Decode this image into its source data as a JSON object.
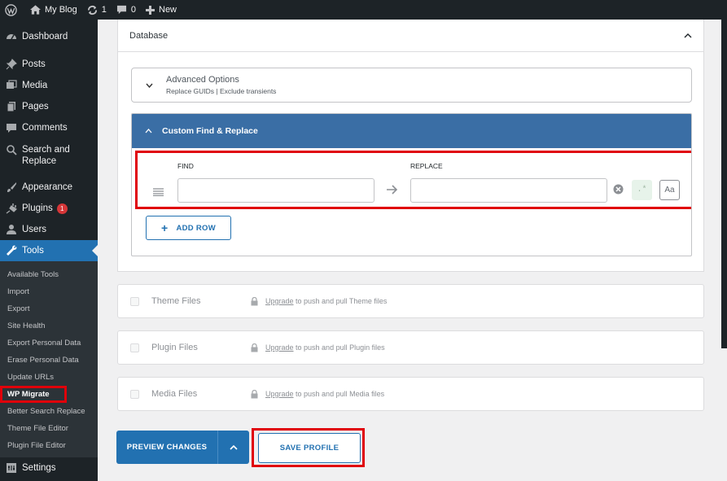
{
  "adminbar": {
    "site_name": "My Blog",
    "updates_count": "1",
    "comments_count": "0",
    "new_label": "New"
  },
  "sidebar": {
    "items": [
      {
        "label": "Dashboard",
        "icon": "dashboard-icon"
      },
      {
        "label": "Posts",
        "icon": "pin-icon"
      },
      {
        "label": "Media",
        "icon": "media-icon"
      },
      {
        "label": "Pages",
        "icon": "pages-icon"
      },
      {
        "label": "Comments",
        "icon": "comment-icon"
      },
      {
        "label": "Search and Replace",
        "icon": "search-icon"
      },
      {
        "label": "Appearance",
        "icon": "brush-icon"
      },
      {
        "label": "Plugins",
        "icon": "plugin-icon",
        "badge": "1"
      },
      {
        "label": "Users",
        "icon": "user-icon"
      },
      {
        "label": "Tools",
        "icon": "wrench-icon"
      },
      {
        "label": "Settings",
        "icon": "settings-icon"
      }
    ],
    "tools_submenu": [
      "Available Tools",
      "Import",
      "Export",
      "Site Health",
      "Export Personal Data",
      "Erase Personal Data",
      "Update URLs",
      "WP Migrate",
      "Better Search Replace",
      "Theme File Editor",
      "Plugin File Editor"
    ]
  },
  "database": {
    "title": "Database",
    "advanced_title": "Advanced Options",
    "advanced_sub": "Replace GUIDs | Exclude transients",
    "cfr_title": "Custom Find & Replace",
    "find_label": "FIND",
    "replace_label": "REPLACE",
    "find_value": "",
    "replace_value": "",
    "regex_label": ".*",
    "case_label": "Aa",
    "add_row_label": "ADD ROW"
  },
  "files": [
    {
      "title": "Theme Files",
      "link": "Upgrade",
      "text": " to push and pull Theme files"
    },
    {
      "title": "Plugin Files",
      "link": "Upgrade",
      "text": " to push and pull Plugin files"
    },
    {
      "title": "Media Files",
      "link": "Upgrade",
      "text": " to push and pull Media files"
    }
  ],
  "actions": {
    "preview_label": "PREVIEW CHANGES",
    "save_label": "SAVE PROFILE"
  },
  "colors": {
    "accent": "#2271b1",
    "header_blue": "#3a6ea5",
    "highlight_red": "#e0000a"
  }
}
